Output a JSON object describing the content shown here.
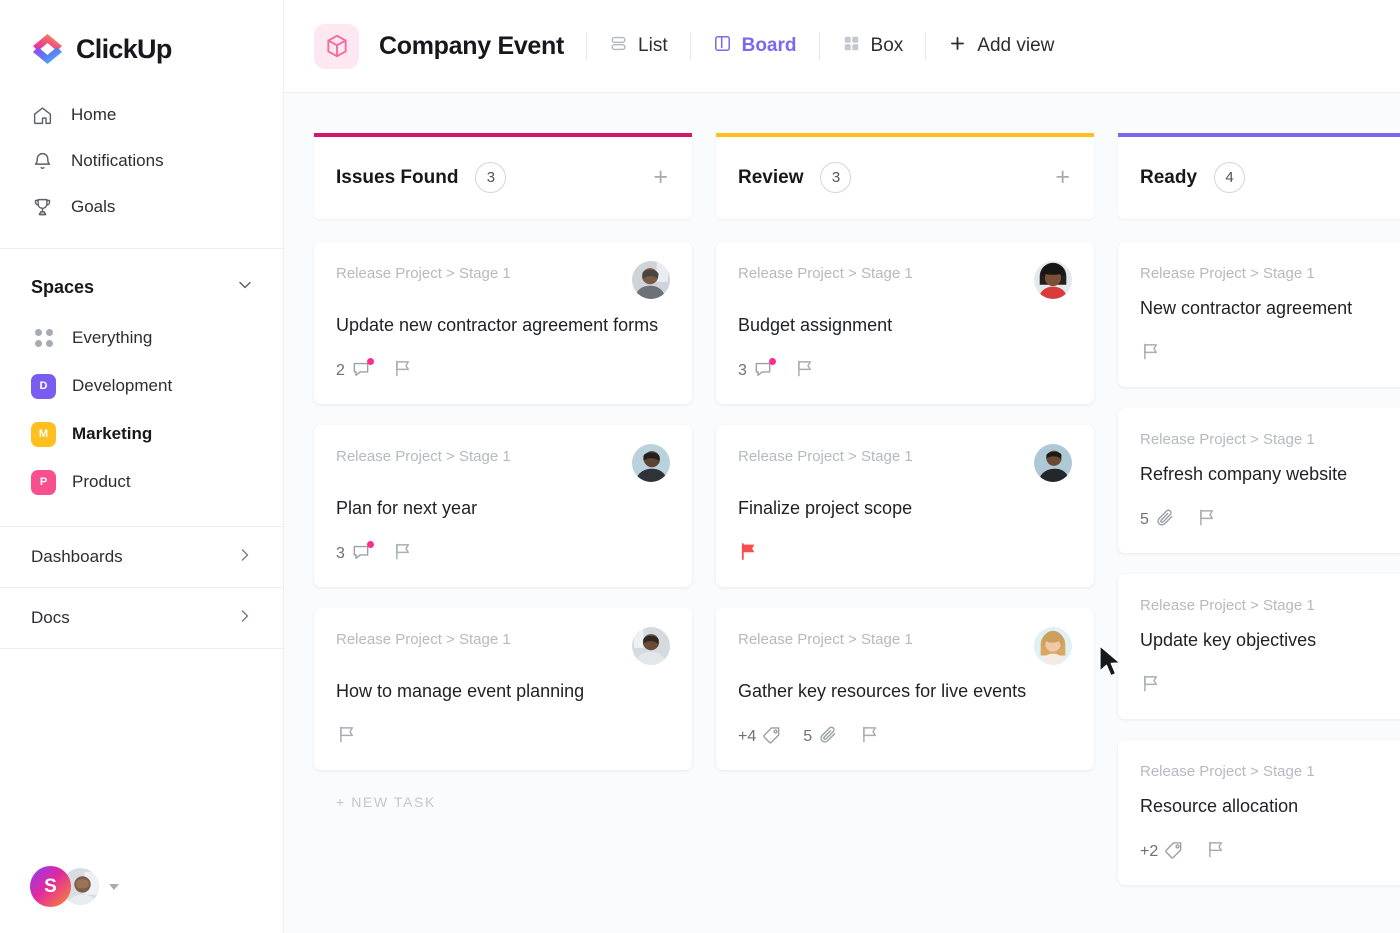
{
  "brand": {
    "name": "ClickUp",
    "logo_icon": "clickup-logo-icon"
  },
  "sidebar": {
    "nav": [
      {
        "label": "Home",
        "icon": "home-icon"
      },
      {
        "label": "Notifications",
        "icon": "bell-icon"
      },
      {
        "label": "Goals",
        "icon": "trophy-icon"
      }
    ],
    "spaces_section": {
      "title": "Spaces",
      "chevron_icon": "chevron-down-icon"
    },
    "spaces": [
      {
        "label": "Everything",
        "icon": "grid-dots-icon",
        "badge": null,
        "color": null,
        "active": false
      },
      {
        "label": "Development",
        "icon": "space-badge",
        "badge": "D",
        "color": "#7b5cf0",
        "active": false
      },
      {
        "label": "Marketing",
        "icon": "space-badge",
        "badge": "M",
        "color": "#ffc01f",
        "active": true
      },
      {
        "label": "Product",
        "icon": "space-badge",
        "badge": "P",
        "color": "#f8508e",
        "active": false
      }
    ],
    "links": [
      {
        "label": "Dashboards",
        "icon": "chevron-right-icon"
      },
      {
        "label": "Docs",
        "icon": "chevron-right-icon"
      }
    ],
    "footer": {
      "workspace_initial": "S",
      "avatar_icon": "user-avatar",
      "caret_icon": "caret-down-icon"
    }
  },
  "header": {
    "project_icon": "cube-icon",
    "title": "Company Event",
    "views": [
      {
        "label": "List",
        "icon": "list-view-icon",
        "active": false
      },
      {
        "label": "Board",
        "icon": "board-view-icon",
        "active": true
      },
      {
        "label": "Box",
        "icon": "box-view-icon",
        "active": false
      }
    ],
    "add_view": {
      "label": "Add view",
      "icon": "plus-icon"
    }
  },
  "accent_colors": {
    "issues_found": "#d4176a",
    "review": "#ffc01f",
    "ready": "#7b68ee",
    "brand_purple": "#7b68ee",
    "flag_red": "#fb4b4b",
    "unread_dot": "#ff2d8a"
  },
  "board": {
    "new_task_label": "+ NEW TASK",
    "add_card_icon": "plus-icon",
    "columns": [
      {
        "name": "Issues Found",
        "count": "3",
        "color": "#d4176a",
        "show_add": true,
        "show_new_task": true,
        "cards": [
          {
            "breadcrumb": "Release Project > Stage 1",
            "title": "Update new contractor agreement forms",
            "avatar": "avatar-man-grey",
            "meta": [
              {
                "icon": "comment-icon",
                "value": "2",
                "unread": true
              }
            ],
            "flag": "outline"
          },
          {
            "breadcrumb": "Release Project > Stage 1",
            "title": "Plan for next year",
            "avatar": "avatar-man-blue",
            "meta": [
              {
                "icon": "comment-icon",
                "value": "3",
                "unread": true
              }
            ],
            "flag": "outline"
          },
          {
            "breadcrumb": "Release Project > Stage 1",
            "title": "How to manage event planning",
            "avatar": "avatar-man-grey2",
            "meta": [],
            "flag": "outline"
          }
        ]
      },
      {
        "name": "Review",
        "count": "3",
        "color": "#ffc01f",
        "show_add": true,
        "show_new_task": false,
        "cards": [
          {
            "breadcrumb": "Release Project > Stage 1",
            "title": "Budget assignment",
            "avatar": "avatar-woman-red",
            "meta": [
              {
                "icon": "comment-icon",
                "value": "3",
                "unread": true
              }
            ],
            "flag": "outline"
          },
          {
            "breadcrumb": "Release Project > Stage 1",
            "title": "Finalize project scope",
            "avatar": "avatar-man-blue2",
            "meta": [],
            "flag": "filled-red"
          },
          {
            "breadcrumb": "Release Project > Stage 1",
            "title": "Gather key resources for live events",
            "avatar": "avatar-woman-blonde",
            "meta": [
              {
                "icon": "tag-icon",
                "value": "+4",
                "unread": false
              },
              {
                "icon": "paperclip-icon",
                "value": "5",
                "unread": false
              }
            ],
            "flag": "outline"
          }
        ]
      },
      {
        "name": "Ready",
        "count": "4",
        "color": "#7b68ee",
        "show_add": false,
        "show_new_task": false,
        "cards": [
          {
            "breadcrumb": "Release Project > Stage 1",
            "title": "New contractor agreement",
            "avatar": null,
            "meta": [],
            "flag": "outline"
          },
          {
            "breadcrumb": "Release Project > Stage 1",
            "title": "Refresh company website",
            "avatar": null,
            "meta": [
              {
                "icon": "paperclip-icon",
                "value": "5",
                "unread": false
              }
            ],
            "flag": "outline"
          },
          {
            "breadcrumb": "Release Project > Stage 1",
            "title": "Update key objectives",
            "avatar": null,
            "meta": [],
            "flag": "outline"
          },
          {
            "breadcrumb": "Release Project > Stage 1",
            "title": "Resource allocation",
            "avatar": null,
            "meta": [
              {
                "icon": "tag-icon",
                "value": "+2",
                "unread": false
              }
            ],
            "flag": "outline"
          }
        ]
      }
    ]
  }
}
